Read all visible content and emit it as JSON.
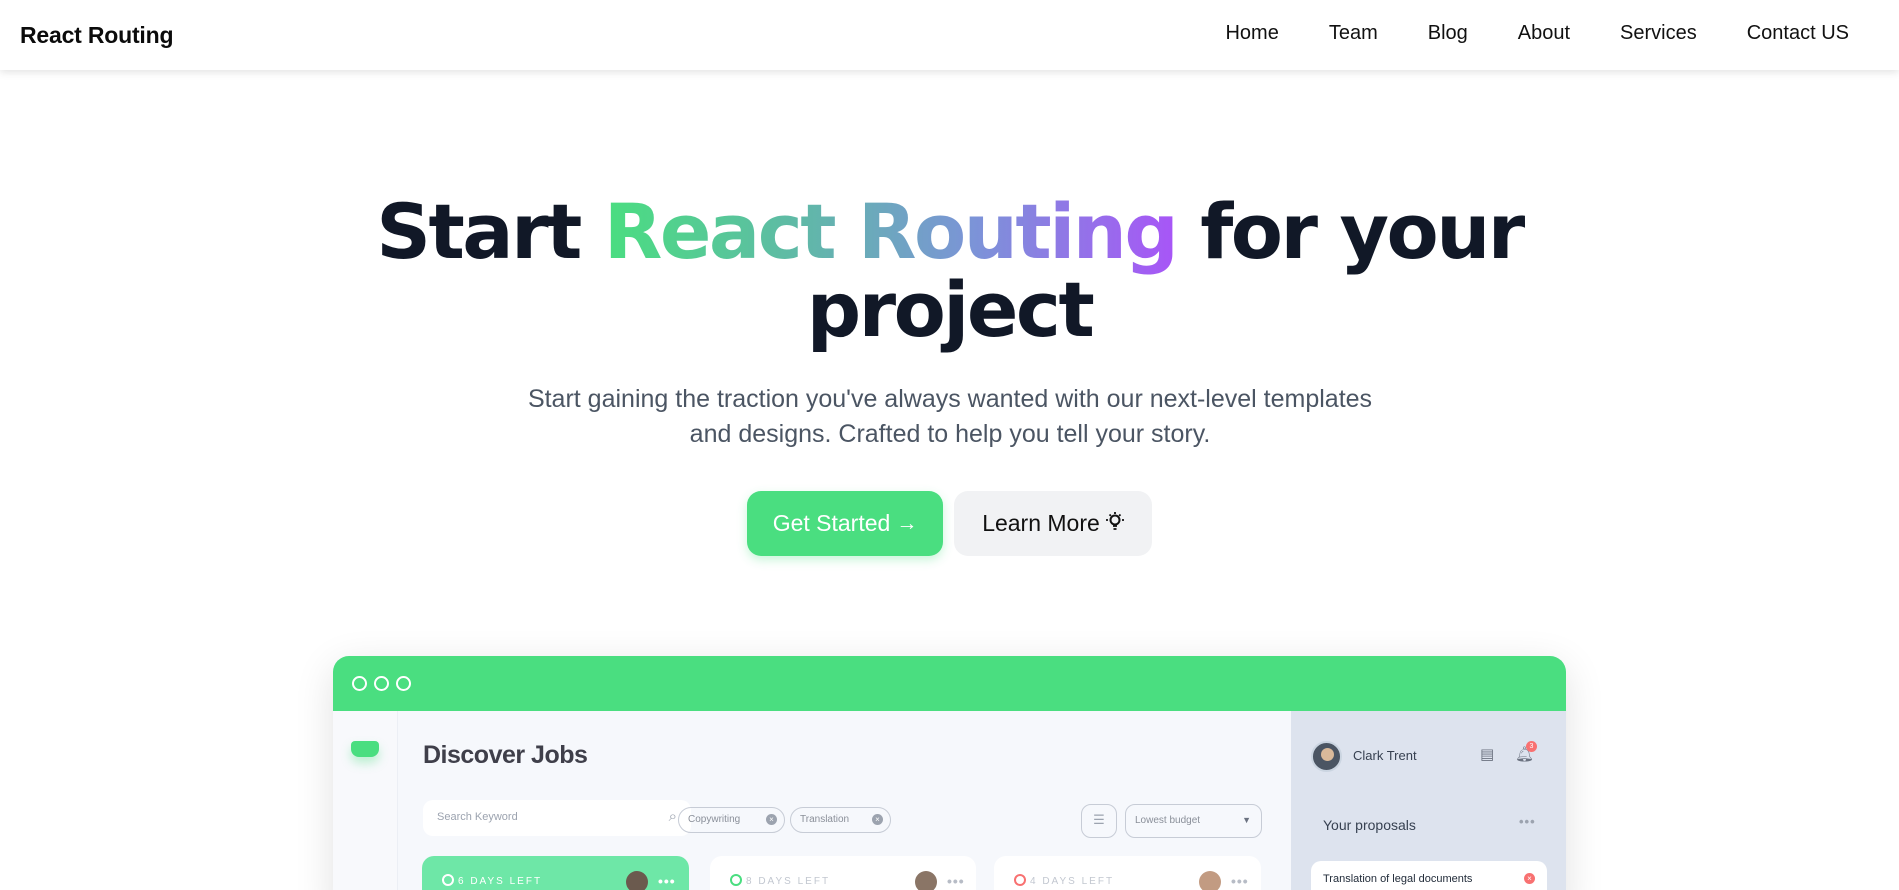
{
  "navbar": {
    "brand": "React Routing",
    "links": [
      "Home",
      "Team",
      "Blog",
      "About",
      "Services",
      "Contact US"
    ]
  },
  "hero": {
    "title_start": "Start ",
    "title_highlight": "React Routing",
    "title_end_line1": " for your",
    "title_line2": "project",
    "subtitle_line1": "Start gaining the traction you've always wanted with our next-level templates",
    "subtitle_line2": "and designs. Crafted to help you tell your story.",
    "primary_button": "Get Started",
    "primary_button_icon": "→",
    "secondary_button": "Learn More",
    "secondary_button_icon": "💡"
  },
  "mockup": {
    "page_title": "Discover Jobs",
    "search_placeholder": "Search Keyword",
    "chips": [
      "Copywriting",
      "Translation"
    ],
    "sort_select": "Lowest budget",
    "cards": [
      {
        "days": "6 DAYS LEFT",
        "ring_color": "#ffffff"
      },
      {
        "days": "8 DAYS LEFT",
        "ring_color": "#4ade80"
      },
      {
        "days": "4 DAYS LEFT",
        "ring_color": "#f87171"
      }
    ],
    "user_name": "Clark Trent",
    "notification_count": "3",
    "proposals_title": "Your proposals",
    "proposal_item": "Translation of legal documents"
  },
  "colors": {
    "accent": "#4ade80",
    "gradient_start": "#4ade80",
    "gradient_end": "#a855f7",
    "text_dark": "#111827"
  }
}
